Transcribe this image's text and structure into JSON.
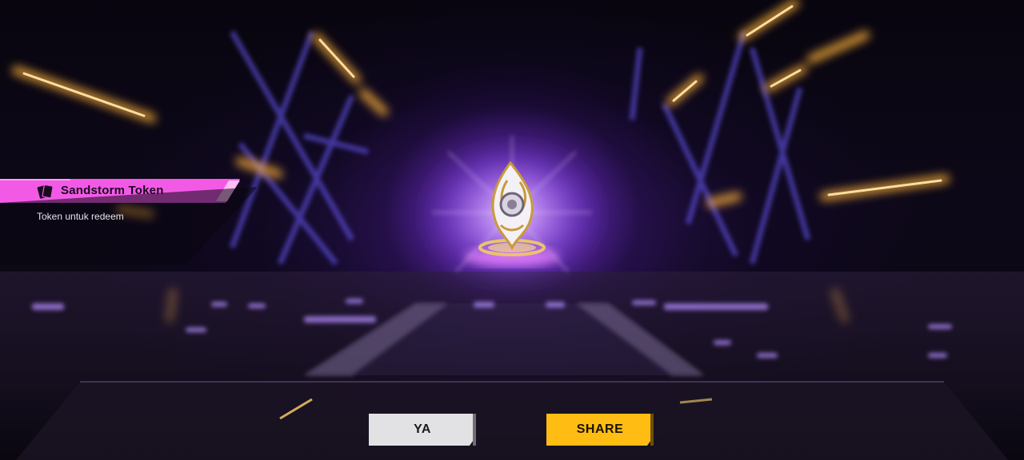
{
  "reward": {
    "item_name": "Sandstorm Token",
    "item_description": "Token untuk redeem",
    "item_icon": "card-deck-icon",
    "emblem_icon": "sandstorm-token-emblem-icon"
  },
  "actions": {
    "confirm_label": "YA",
    "share_label": "SHARE"
  },
  "colors": {
    "banner_pink": "#f25ae6",
    "share_yellow": "#ffbc12",
    "confirm_grey": "#e2e2e4",
    "glow_purple": "#a85cff",
    "light_orange": "#ffb23a"
  }
}
